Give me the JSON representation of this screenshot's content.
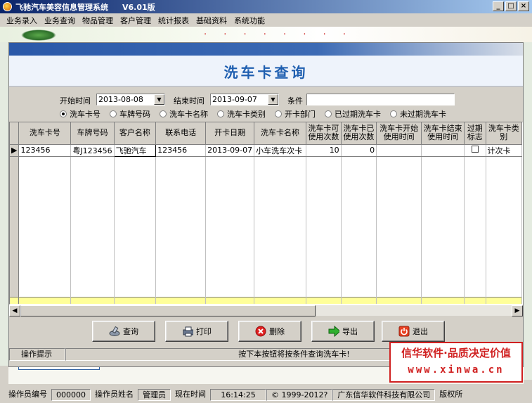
{
  "window": {
    "title": "飞驰汽车美容信息管理系统",
    "version": "V6.01版",
    "controls": [
      "_",
      "□",
      "×"
    ]
  },
  "menu": [
    "业务录入",
    "业务查询",
    "物品管理",
    "客户管理",
    "统计报表",
    "基础资料",
    "系统功能"
  ],
  "dialog": {
    "title": "洗车卡查询",
    "start_label": "开始时间",
    "start_value": "2013-08-08",
    "end_label": "结束时间",
    "end_value": "2013-09-07",
    "cond_label": "条件",
    "cond_value": "",
    "radios": [
      {
        "label": "洗车卡号",
        "checked": true
      },
      {
        "label": "车牌号码",
        "checked": false
      },
      {
        "label": "洗车卡名称",
        "checked": false
      },
      {
        "label": "洗车卡类别",
        "checked": false
      },
      {
        "label": "开卡部门",
        "checked": false
      },
      {
        "label": "已过期洗车卡",
        "checked": false
      },
      {
        "label": "未过期洗车卡",
        "checked": false
      }
    ],
    "table": {
      "columns": [
        "洗车卡号",
        "车牌号码",
        "客户名称",
        "联系电话",
        "开卡日期",
        "洗车卡名称",
        "洗车卡可使用次数",
        "洗车卡已使用次数",
        "洗车卡开始使用时间",
        "洗车卡结束使用时间",
        "过期标志",
        "洗车卡类别"
      ],
      "rows": [
        [
          "123456",
          "粤J123456",
          "飞驰汽车",
          "123456",
          "2013-09-07",
          "小车洗车次卡",
          "10",
          "0",
          "",
          "",
          "",
          "计次卡"
        ]
      ]
    },
    "buttons": {
      "query": "查询",
      "print": "打印",
      "delete": "删除",
      "export": "导出",
      "exit": "退出"
    },
    "hint_label": "操作提示",
    "hint_text": "按下本按钮将按条件查询洗车卡!"
  },
  "status": {
    "op_id_label": "操作员编号",
    "op_id": "000000",
    "op_name_label": "操作员姓名",
    "op_name": "管理员",
    "time_label": "现在时间",
    "time": "16:14:25",
    "copyright": "© 1999-2012?",
    "company": "广东信华软件科技有限公司",
    "rights": "版权所"
  },
  "ad": {
    "line1": "信华软件·品质决定价值",
    "line2": "www.xinwa.cn"
  },
  "background": {
    "slogan": "· · · · · · · ·"
  },
  "colors": {
    "accent": "#1f5fb0",
    "highlight_row": "#ffff99",
    "ad_red": "#d02020"
  }
}
